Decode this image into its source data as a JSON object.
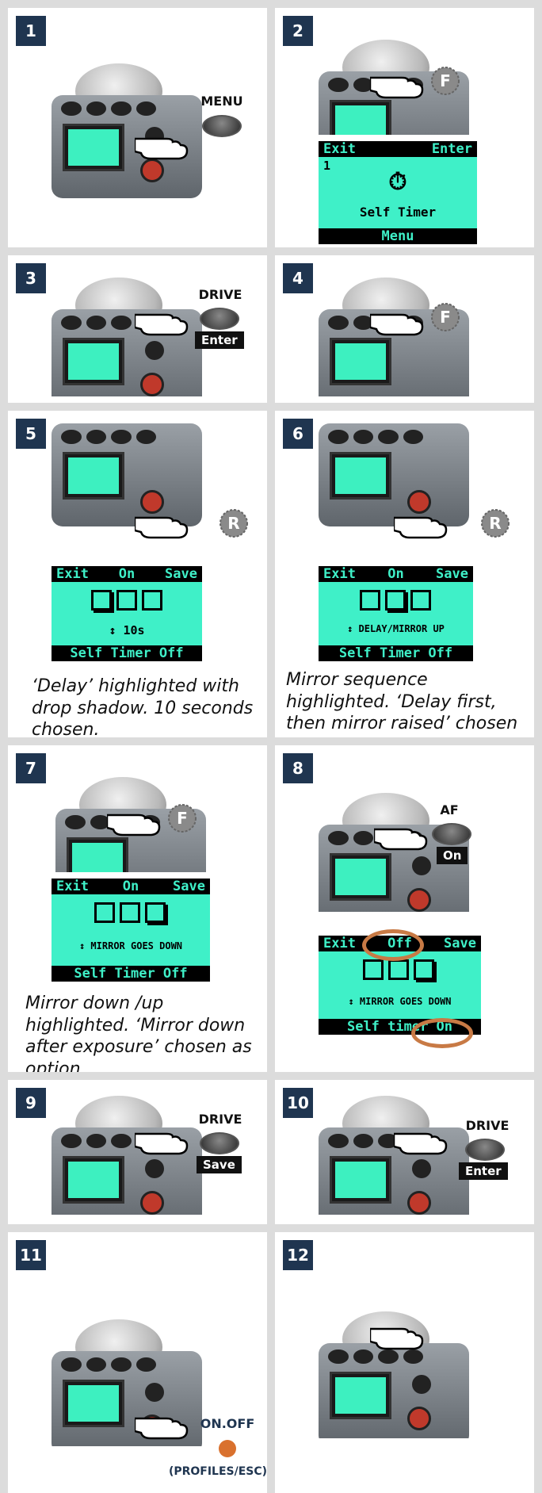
{
  "panels": [
    {
      "n": "1",
      "button": "MENU"
    },
    {
      "n": "2",
      "dial": "F",
      "lcd": {
        "left": "Exit",
        "right": "Enter",
        "number": "1",
        "title": "Self Timer",
        "bottom": "Menu"
      }
    },
    {
      "n": "3",
      "button": "DRIVE",
      "tag": "Enter"
    },
    {
      "n": "4",
      "dial": "F"
    },
    {
      "n": "5",
      "dial": "R",
      "lcd": {
        "left": "Exit",
        "mid": "On",
        "right": "Save",
        "value": "↕ 10s",
        "bottom": "Self Timer Off"
      },
      "caption": "‘Delay’ highlighted with drop shadow. 10 seconds chosen."
    },
    {
      "n": "6",
      "dial": "R",
      "lcd": {
        "left": "Exit",
        "mid": "On",
        "right": "Save",
        "value": "↕ DELAY/MIRROR UP",
        "bottom": "Self Timer Off"
      },
      "caption": "Mirror sequence highlighted. ‘Delay first, then mirror raised’ chosen as option."
    },
    {
      "n": "7",
      "dial": "F",
      "lcd": {
        "left": "Exit",
        "mid": "On",
        "right": "Save",
        "value": "↕ MIRROR GOES DOWN",
        "bottom": "Self Timer Off"
      },
      "caption": "Mirror down /up highlighted. ‘Mirror down after exposure’ chosen as option."
    },
    {
      "n": "8",
      "button": "AF",
      "tag": "On",
      "lcd": {
        "left": "Exit",
        "mid": "Off",
        "right": "Save",
        "value": "↕ MIRROR GOES DOWN",
        "bottom": "Self timer On"
      }
    },
    {
      "n": "9",
      "button": "DRIVE",
      "tag": "Save"
    },
    {
      "n": "10",
      "button": "DRIVE",
      "tag": "Enter"
    },
    {
      "n": "11",
      "button": "ON.OFF",
      "sub": "(PROFILES/ESC)"
    },
    {
      "n": "12"
    }
  ],
  "colors": {
    "badge": "#1f3550",
    "lcd": "#3ff0c8",
    "ring": "#c87a45",
    "onoff": "#d9712e"
  }
}
